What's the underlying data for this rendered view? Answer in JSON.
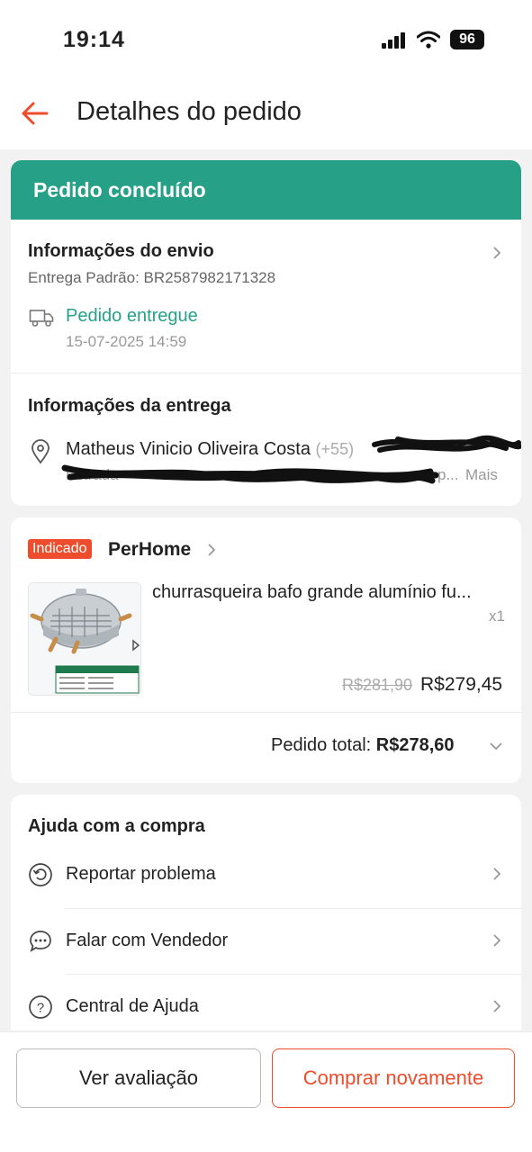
{
  "status": {
    "time": "19:14",
    "battery": "96"
  },
  "header": {
    "title": "Detalhes do pedido"
  },
  "order_status": {
    "label": "Pedido concluído",
    "color": "#26a187"
  },
  "shipping": {
    "title": "Informações do envio",
    "method": "Entrega Padrão: BR2587982171328",
    "status": "Pedido entregue",
    "date": "15-07-2025 14:59"
  },
  "delivery": {
    "title": "Informações da entrega",
    "name": "Matheus Vinicio Oliveira Costa",
    "phone_prefix": "(+55)",
    "address_partial": "Estrada",
    "address_tail": "p...",
    "more": "Mais"
  },
  "product": {
    "badge": "Indicado",
    "shop": "PerHome",
    "name": "churrasqueira bafo grande alumínio fu...",
    "qty": "x1",
    "old_price": "R$281,90",
    "price": "R$279,45",
    "total_label": "Pedido total:",
    "total_value": "R$278,60"
  },
  "help": {
    "title": "Ajuda com a compra",
    "items": [
      {
        "label": "Reportar problema",
        "icon": "report-icon"
      },
      {
        "label": "Falar com Vendedor",
        "icon": "chat-icon"
      },
      {
        "label": "Central de Ajuda",
        "icon": "help-icon"
      }
    ]
  },
  "actions": {
    "review": "Ver avaliação",
    "buy_again": "Comprar novamente"
  },
  "colors": {
    "accent": "#ee4d2d",
    "success": "#26a187"
  }
}
